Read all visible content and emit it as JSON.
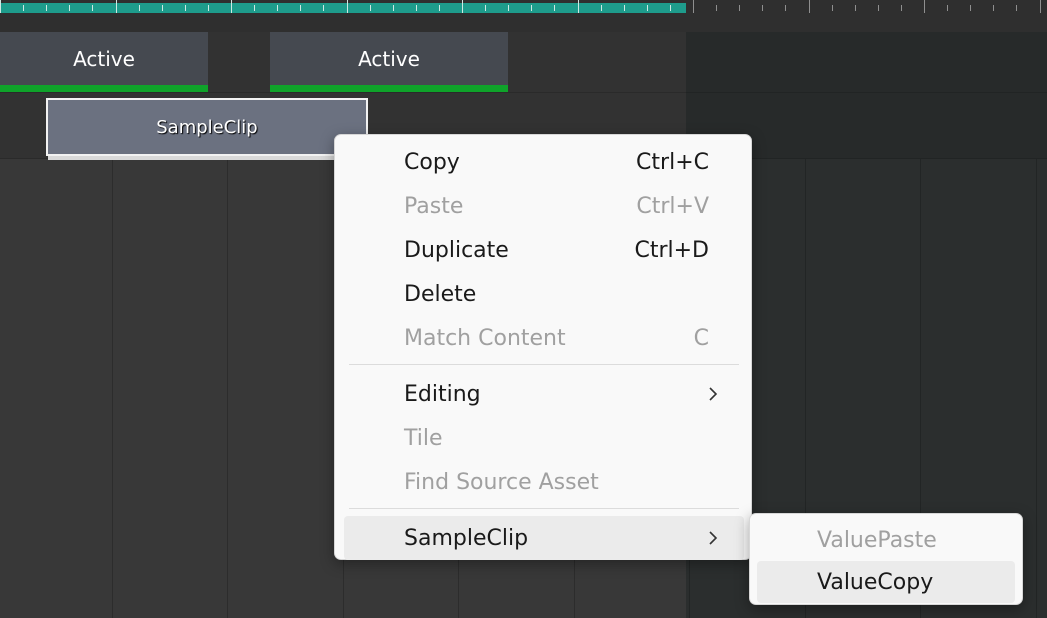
{
  "timeline": {
    "activation_blocks": [
      {
        "label": "Active"
      },
      {
        "label": "Active"
      }
    ],
    "clip": {
      "label": "SampleClip"
    },
    "colors": {
      "ruler_active": "#1e9c8c",
      "activation_bar": "#0fa32a",
      "clip_fill": "#6b7180"
    }
  },
  "context_menu": {
    "items": [
      {
        "label": "Copy",
        "shortcut": "Ctrl+C",
        "enabled": true
      },
      {
        "label": "Paste",
        "shortcut": "Ctrl+V",
        "enabled": false
      },
      {
        "label": "Duplicate",
        "shortcut": "Ctrl+D",
        "enabled": true
      },
      {
        "label": "Delete",
        "shortcut": "",
        "enabled": true
      },
      {
        "label": "Match Content",
        "shortcut": "C",
        "enabled": false
      },
      {
        "label": "Editing",
        "shortcut": "",
        "enabled": true,
        "submenu": true,
        "icon": "chevron-right-icon"
      },
      {
        "label": "Tile",
        "shortcut": "",
        "enabled": false
      },
      {
        "label": "Find Source Asset",
        "shortcut": "",
        "enabled": false
      },
      {
        "label": "SampleClip",
        "shortcut": "",
        "enabled": true,
        "submenu": true,
        "highlighted": true,
        "icon": "chevron-right-icon"
      }
    ],
    "submenu": {
      "items": [
        {
          "label": "ValuePaste",
          "enabled": false
        },
        {
          "label": "ValueCopy",
          "enabled": true,
          "highlighted": true
        }
      ]
    }
  }
}
